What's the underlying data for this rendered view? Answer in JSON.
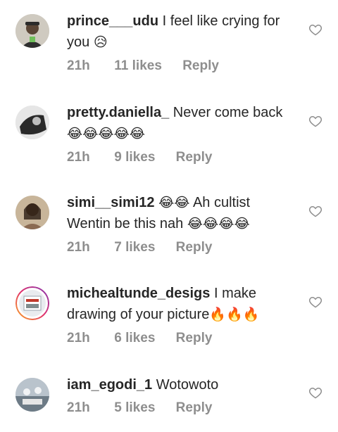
{
  "comments": [
    {
      "user": "prince___udu",
      "text": "I feel like crying for you",
      "emoji": "😥",
      "time": "21h",
      "likes": "11 likes",
      "reply": "Reply"
    },
    {
      "user": "pretty.daniella_",
      "text": "Never come back",
      "emoji": "😂😂😂😂😂",
      "time": "21h",
      "likes": "9 likes",
      "reply": "Reply"
    },
    {
      "user": "simi__simi12",
      "emoji_lead": "😂😂",
      "text": "Ah cultist Wentin be this nah",
      "emoji": "😂😂😂😂",
      "time": "21h",
      "likes": "7 likes",
      "reply": "Reply"
    },
    {
      "user": "michealtunde_desigs",
      "text": "I make drawing of your picture",
      "emoji": "🔥🔥🔥",
      "time": "21h",
      "likes": "6 likes",
      "reply": "Reply"
    },
    {
      "user": "iam_egodi_1",
      "text": "Wotowoto",
      "emoji": "",
      "time": "21h",
      "likes": "5 likes",
      "reply": "Reply"
    }
  ]
}
